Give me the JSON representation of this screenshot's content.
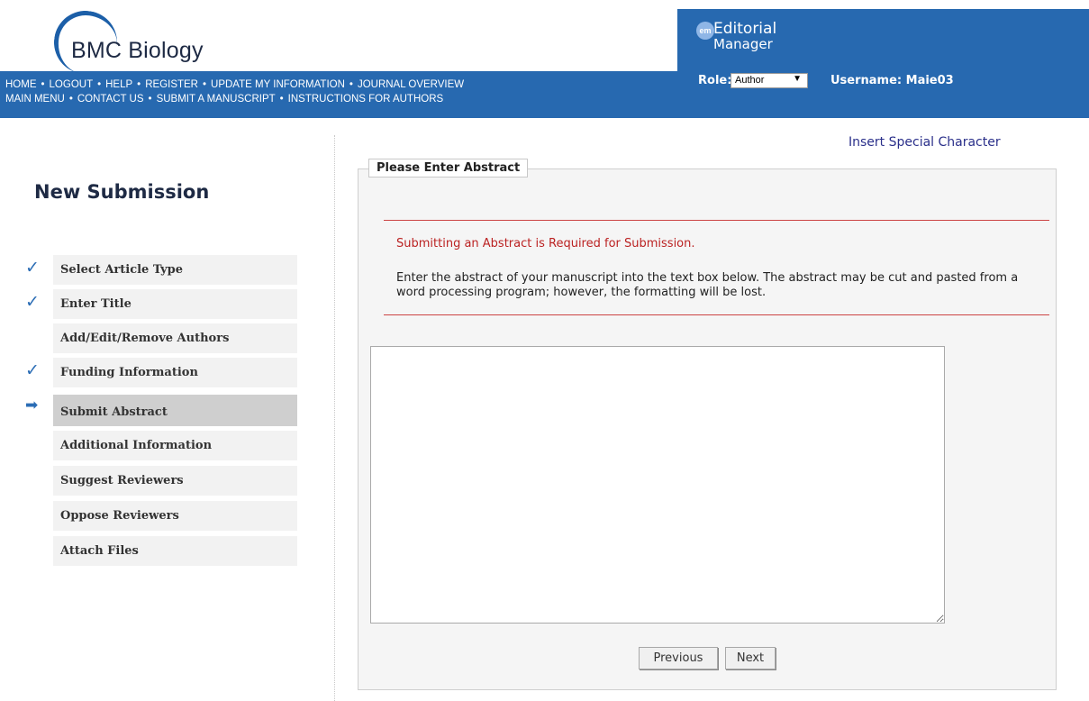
{
  "header": {
    "journal_name": "BMC Biology",
    "nav_row1": [
      "HOME",
      "LOGOUT",
      "HELP",
      "REGISTER",
      "UPDATE MY INFORMATION",
      "JOURNAL OVERVIEW"
    ],
    "nav_row2": [
      "MAIN MENU",
      "CONTACT US",
      "SUBMIT A MANUSCRIPT",
      "INSTRUCTIONS FOR AUTHORS"
    ],
    "nav_separator": "•",
    "em_badge": "em",
    "em_title_line1": "Editorial",
    "em_title_line2": "Manager",
    "role_label": "Role:",
    "role_value": "Author",
    "role_arrow": "▼",
    "username_label": "Username: Maie03"
  },
  "sidebar": {
    "title": "New Submission",
    "steps": [
      {
        "label": "Select Article Type",
        "mark": "✓"
      },
      {
        "label": "Enter Title",
        "mark": "✓"
      },
      {
        "label": "Add/Edit/Remove Authors",
        "mark": ""
      },
      {
        "label": "Funding Information",
        "mark": "✓"
      },
      {
        "label": "Submit Abstract",
        "mark": "➡"
      },
      {
        "label": "Additional Information",
        "mark": ""
      },
      {
        "label": "Suggest Reviewers",
        "mark": ""
      },
      {
        "label": "Oppose Reviewers",
        "mark": ""
      },
      {
        "label": "Attach Files",
        "mark": ""
      }
    ],
    "active_step": "Submit Abstract"
  },
  "main": {
    "insert_special_character": "Insert Special Character",
    "section_legend": "Please Enter Abstract",
    "required_notice": "Submitting an Abstract is Required for Submission.",
    "instructions": "Enter the abstract of your manuscript into the text box below. The abstract may be cut and pasted from a word processing program; however, the formatting will be lost.",
    "abstract_value": "",
    "previous_label": "Previous",
    "next_label": "Next"
  },
  "colors": {
    "header_blue": "#2769b0",
    "notice_red": "#b22222",
    "check_blue": "#2b6db5",
    "link_purple": "#2a2f8a"
  }
}
